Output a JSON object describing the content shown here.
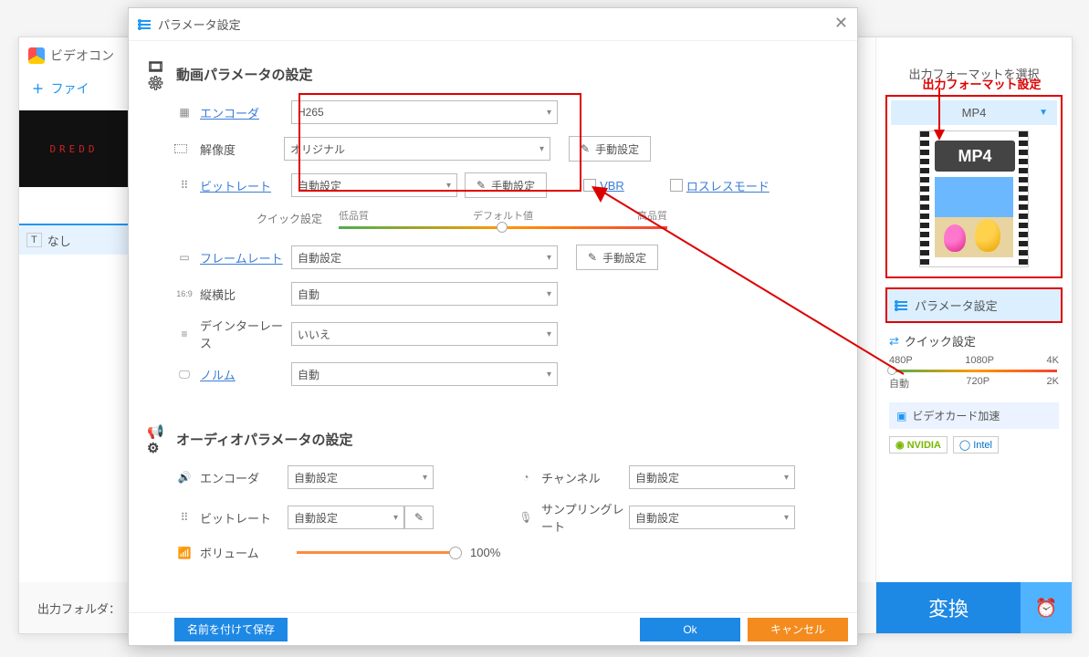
{
  "bg": {
    "title": "ビデオコン",
    "file_add": "ファイ",
    "thumb_text": "DREDD",
    "subtitle_none": "なし",
    "output_folder": "出力フォルダ："
  },
  "annotation": "出力フォーマット設定",
  "right": {
    "select_format": "出力フォーマットを選択",
    "format": "MP4",
    "mp4_badge": "MP4",
    "param_settings": "パラメータ設定",
    "quick_settings": "クイック設定",
    "scale_top": [
      "480P",
      "1080P",
      "4K"
    ],
    "scale_bot": [
      "自動",
      "720P",
      "2K"
    ],
    "gpu_accel": "ビデオカード加速",
    "nvidia": "NVIDIA",
    "intel": "Intel",
    "convert": "変換"
  },
  "dialog": {
    "title": "パラメータ設定",
    "video_section": "動画パラメータの設定",
    "audio_section": "オーディオパラメータの設定",
    "labels": {
      "encoder": "エンコーダ",
      "resolution": "解像度",
      "bitrate": "ビットレート",
      "framerate": "フレームレート",
      "aspect": "縦横比",
      "deinterlace": "デインターレース",
      "norm": "ノルム",
      "channel": "チャンネル",
      "samplerate": "サンプリングレート",
      "volume": "ボリューム",
      "quick_set": "クイック設定"
    },
    "values": {
      "encoder": "H265",
      "resolution": "オリジナル",
      "bitrate": "自動設定",
      "framerate": "自動設定",
      "aspect": "自動",
      "deinterlace": "いいえ",
      "norm": "自動",
      "audio_encoder": "自動設定",
      "audio_bitrate": "自動設定",
      "channel": "自動設定",
      "samplerate": "自動設定",
      "volume": "100%"
    },
    "buttons": {
      "manual": "手動設定",
      "save_as": "名前を付けて保存",
      "ok": "Ok",
      "cancel": "キャンセル"
    },
    "quality": {
      "low": "低品質",
      "default": "デフォルト値",
      "high": "高品質"
    },
    "vbr": "VBR",
    "lossless": "ロスレスモード"
  }
}
